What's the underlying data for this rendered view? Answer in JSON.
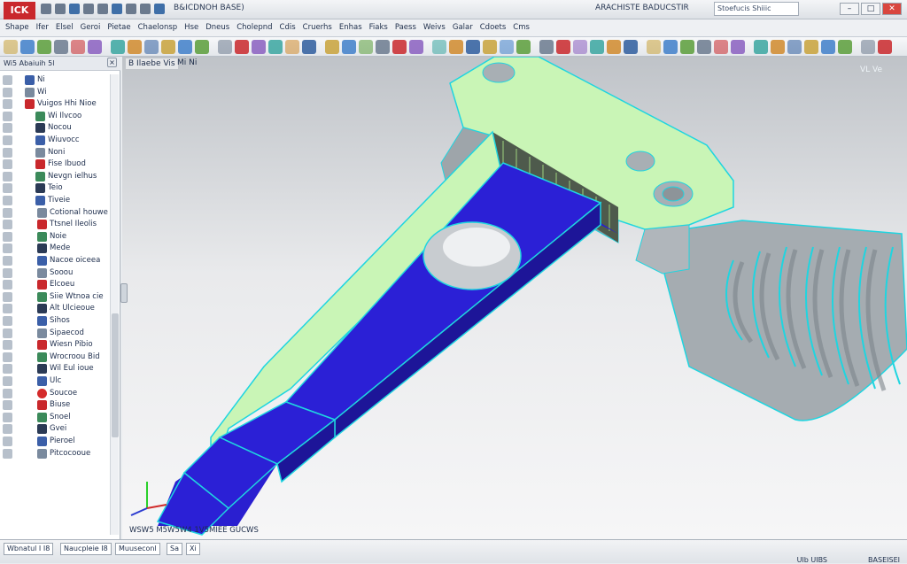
{
  "app": {
    "logo": "ICK",
    "title": "B&ICDNOH BASE)",
    "title_right": "ARACHISTE BADUCSTIR",
    "search_placeholder": "Stoefucis Shiiic"
  },
  "menu": [
    "Shape",
    "Ifer",
    "Elsel",
    "Geroi",
    "Pietae",
    "Chaelonsp",
    "Hse",
    "Dneus",
    "Cholepnd",
    "Cdis",
    "Cruerhs",
    "Enhas",
    "Fiaks",
    "Paess",
    "Weivs",
    "Galar",
    "Cdoets",
    "Cms"
  ],
  "tree": {
    "header": "Wi5 Abaiuih 5l",
    "items": [
      {
        "label": "Ni",
        "depth": 1
      },
      {
        "label": "Wi",
        "depth": 1
      },
      {
        "label": "Vuigos Hhi Nioe",
        "depth": 1
      },
      {
        "label": "Wi Ilvcoo",
        "depth": 2
      },
      {
        "label": "Nocou",
        "depth": 2
      },
      {
        "label": "Wiuvocc",
        "depth": 2
      },
      {
        "label": "Noni",
        "depth": 2
      },
      {
        "label": "Fise Ibuod",
        "depth": 2
      },
      {
        "label": "Nevgn ielhus",
        "depth": 2
      },
      {
        "label": "Teio",
        "depth": 2
      },
      {
        "label": "Tiveie",
        "depth": 2
      },
      {
        "label": "Cotional houwe",
        "depth": 3
      },
      {
        "label": "Ttsnel Ileolis",
        "depth": 3
      },
      {
        "label": "Noie",
        "depth": 3
      },
      {
        "label": "Mede",
        "depth": 3
      },
      {
        "label": "Nacoe oiceea",
        "depth": 3
      },
      {
        "label": "Sooou",
        "depth": 3
      },
      {
        "label": "Elcoeu",
        "depth": 3
      },
      {
        "label": "Siie Wtnoa cie",
        "depth": 3
      },
      {
        "label": "Alt Ulcieoue",
        "depth": 3
      },
      {
        "label": "Sihos",
        "depth": 3
      },
      {
        "label": "Sipaecod",
        "depth": 3
      },
      {
        "label": "Wiesn Pibio",
        "depth": 3
      },
      {
        "label": "Wrocroou Bid",
        "depth": 3
      },
      {
        "label": "Wil Eul ioue",
        "depth": 3
      },
      {
        "label": "Ulc",
        "depth": 3
      },
      {
        "label": "Soucoe",
        "depth": 3
      },
      {
        "label": "Biuse",
        "depth": 3
      },
      {
        "label": "Snoel",
        "depth": 3
      },
      {
        "label": "Gvei",
        "depth": 3
      },
      {
        "label": "Pieroel",
        "depth": 3
      },
      {
        "label": "Pitcocooue",
        "depth": 3
      }
    ]
  },
  "viewport": {
    "label": "B Ilaebe Vis",
    "label2": "Mi Ni",
    "top_right": "VL Ve",
    "status": "WSW5 M5W5W4 1V5MIEE GUCWS"
  },
  "status": {
    "tabs": [
      "Wbnatul I I8",
      "Naucpleie I8",
      "Muuseconl",
      "Sa",
      "Xi"
    ],
    "right": "Ulb UIBS",
    "right2": "BASEISEI"
  },
  "colors": {
    "accent": "#c9282c",
    "part_blue": "#2a1fd0",
    "part_green": "#c9f5b6",
    "edge": "#1fd5e0",
    "gray_part": "#a9afb4"
  }
}
